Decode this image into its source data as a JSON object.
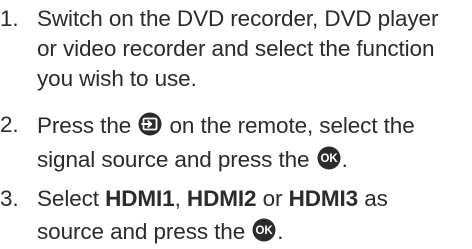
{
  "steps": [
    {
      "number": "1.",
      "lines": [
        "Switch on the DVD recorder, DVD player",
        "or video recorder and select the function",
        "you wish to use."
      ]
    },
    {
      "number": "2.",
      "line1_a": "Press the",
      "line1_b": "on the remote, select the",
      "line2_a": "signal source and press the",
      "line2_b": "."
    },
    {
      "number": "3.",
      "line1": {
        "a": "Select",
        "b1": "HDMI1",
        "c": ",",
        "b2": "HDMI2",
        "d": "or",
        "b3": "HDMI3",
        "e": "as"
      },
      "line2_a": "source and press the",
      "line2_b": "."
    }
  ],
  "icons": {
    "source": "input-source-icon",
    "ok": "ok-button-icon",
    "ok_label": "OK"
  },
  "colors": {
    "text": "#2b2b2b",
    "icon_fill": "#2b2b2b",
    "icon_glyph": "#ffffff"
  }
}
